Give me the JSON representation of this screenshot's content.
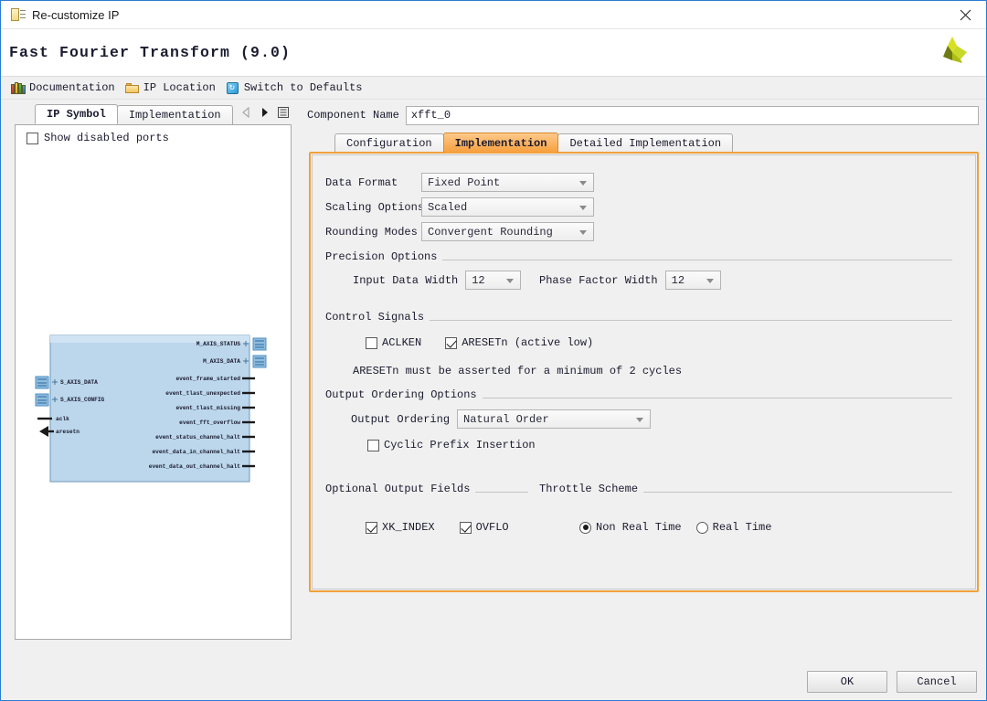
{
  "window": {
    "title": "Re-customize IP",
    "icon": "ip-window-icon",
    "close_icon": "close-icon"
  },
  "header": {
    "ip_title": "Fast Fourier Transform (9.0)",
    "logo_icon": "xilinx-logo-icon"
  },
  "toolbar": {
    "items": [
      {
        "label": "Documentation",
        "icon": "documentation-icon"
      },
      {
        "label": "IP Location",
        "icon": "folder-icon"
      },
      {
        "label": "Switch to Defaults",
        "icon": "refresh-icon"
      }
    ]
  },
  "left_panel": {
    "tabs": [
      {
        "label": "IP Symbol",
        "active": true
      },
      {
        "label": "Implementation",
        "active": false
      }
    ],
    "nav": {
      "prev_icon": "chevron-left-icon",
      "next_icon": "chevron-right-icon",
      "menu_icon": "list-menu-icon"
    },
    "show_disabled_ports": {
      "label": "Show disabled ports",
      "checked": false
    },
    "symbol": {
      "left_ports": [
        {
          "name": "S_AXIS_DATA",
          "type": "bus"
        },
        {
          "name": "S_AXIS_CONFIG",
          "type": "bus"
        },
        {
          "name": "aclk",
          "type": "clock"
        },
        {
          "name": "aresetn",
          "type": "reset"
        }
      ],
      "right_ports": [
        {
          "name": "M_AXIS_STATUS",
          "type": "bus"
        },
        {
          "name": "M_AXIS_DATA",
          "type": "bus"
        },
        {
          "name": "event_frame_started",
          "type": "signal"
        },
        {
          "name": "event_tlast_unexpected",
          "type": "signal"
        },
        {
          "name": "event_tlast_missing",
          "type": "signal"
        },
        {
          "name": "event_fft_overflow",
          "type": "signal"
        },
        {
          "name": "event_status_channel_halt",
          "type": "signal"
        },
        {
          "name": "event_data_in_channel_halt",
          "type": "signal"
        },
        {
          "name": "event_data_out_channel_halt",
          "type": "signal"
        }
      ]
    }
  },
  "right_panel": {
    "component_name": {
      "label": "Component Name",
      "value": "xfft_0"
    },
    "tabs": [
      {
        "label": "Configuration",
        "active": false
      },
      {
        "label": "Implementation",
        "active": true
      },
      {
        "label": "Detailed Implementation",
        "active": false
      }
    ],
    "fields": {
      "data_format": {
        "label": "Data Format",
        "value": "Fixed Point"
      },
      "scaling_options": {
        "label": "Scaling Options",
        "value": "Scaled"
      },
      "rounding_modes": {
        "label": "Rounding Modes",
        "value": "Convergent Rounding"
      }
    },
    "precision": {
      "section": "Precision Options",
      "input_data_width": {
        "label": "Input Data Width",
        "value": "12"
      },
      "phase_factor_width": {
        "label": "Phase Factor Width",
        "value": "12"
      }
    },
    "control_signals": {
      "section": "Control Signals",
      "aclken": {
        "label": "ACLKEN",
        "checked": false
      },
      "aresetn": {
        "label": "ARESETn (active low)",
        "checked": true
      },
      "note": "ARESETn must be asserted for a minimum of 2 cycles"
    },
    "output_ordering": {
      "section": "Output Ordering Options",
      "ordering": {
        "label": "Output Ordering",
        "value": "Natural Order"
      },
      "cyclic_prefix": {
        "label": "Cyclic Prefix Insertion",
        "checked": false
      }
    },
    "optional_output_fields": {
      "section": "Optional Output Fields",
      "xk_index": {
        "label": "XK_INDEX",
        "checked": true
      },
      "ovflo": {
        "label": "OVFLO",
        "checked": true
      }
    },
    "throttle_scheme": {
      "section": "Throttle Scheme",
      "non_real_time": {
        "label": "Non Real Time",
        "selected": true
      },
      "real_time": {
        "label": "Real Time",
        "selected": false
      }
    }
  },
  "footer": {
    "ok": "OK",
    "cancel": "Cancel"
  },
  "colors": {
    "accent_orange": "#f0a13c",
    "tab_active_orange": "#f79f3d",
    "window_border_blue": "#2b7cd3",
    "symbol_fill": "#bcd7ec",
    "bus_port_blue": "#4e8fc7"
  }
}
